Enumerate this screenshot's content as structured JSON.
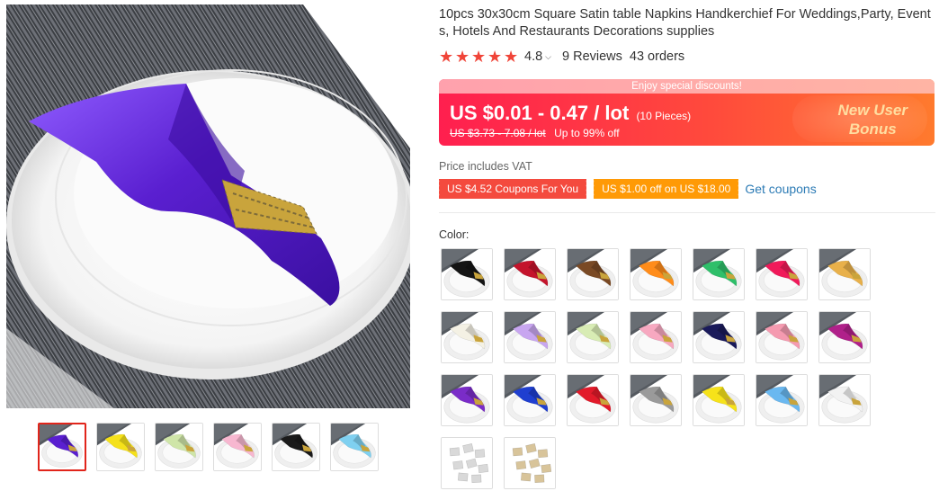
{
  "product": {
    "title": "10pcs 30x30cm Square Satin table Napkins Handkerchief For Weddings,Party, Events, Hotels And Restaurants Decorations supplies",
    "rating": "4.8",
    "reviews": "9 Reviews",
    "orders": "43 orders"
  },
  "price": {
    "banner_note": "Enjoy special discounts!",
    "current": "US $0.01 - 0.47 / lot",
    "unit": "(10 Pieces)",
    "original": "US $3.73 - 7.08 / lot",
    "discount": "Up to 99% off",
    "new_user_line1": "New User",
    "new_user_line2": "Bonus",
    "vat": "Price includes VAT"
  },
  "coupons": {
    "coupon1": "US $4.52 Coupons For You",
    "coupon2": "US $1.00 off on US $18.00",
    "get_link": "Get coupons"
  },
  "color_label": "Color:",
  "colors": {
    "brand_red": "#e1251b",
    "link_blue": "#2c7bb5"
  },
  "gallery": {
    "main_napkin": "#5a1fd0",
    "thumbnails": [
      "#5a1fd0",
      "#f5e11a",
      "#cfe5a8",
      "#f7b7d0",
      "#1a1a1a",
      "#7fd0f0"
    ]
  },
  "swatches": [
    "#141414",
    "#c4142c",
    "#7a4a25",
    "#ff8c1a",
    "#2fbf6a",
    "#f01a5a",
    "#e8b04a",
    "#f4f1e4",
    "#c8a6f0",
    "#d8ecb4",
    "#f7a8c0",
    "#1a1a5a",
    "#f59ab0",
    "#b0208a",
    "#7a2cc8",
    "#1f3fd0",
    "#e21a2a",
    "#9a9a9a",
    "#f6e21a",
    "#6ab8f0",
    "#f2f2f2",
    "#d9d9d9",
    "#d8c49a"
  ]
}
